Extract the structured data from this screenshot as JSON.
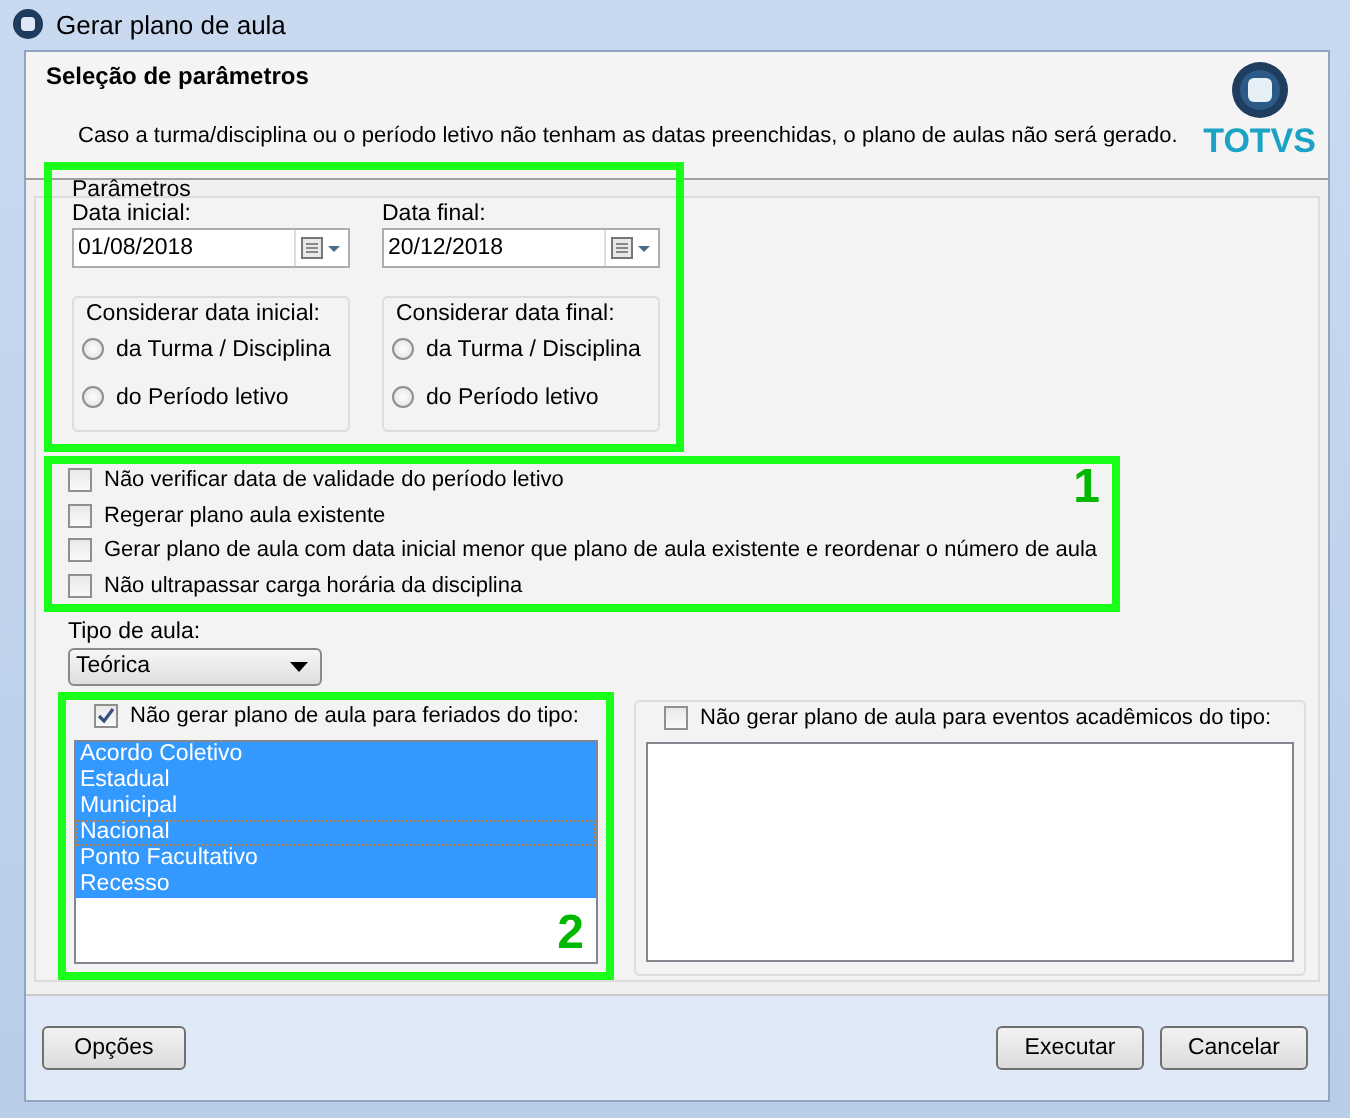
{
  "window": {
    "title": "Gerar plano de aula"
  },
  "header": {
    "title": "Seleção de parâmetros",
    "description": "Caso a turma/disciplina ou o período letivo não tenham as datas preenchidas, o plano de aulas não será gerado.",
    "logo_text": "TOTVS"
  },
  "parameters": {
    "legend": "Parâmetros",
    "highlighted": true,
    "dates": [
      {
        "label": "Data inicial:",
        "value": "01/08/2018",
        "group_label": "Considerar data inicial:",
        "options": [
          {
            "label": "da Turma / Disciplina",
            "selected": false
          },
          {
            "label": "do Período letivo",
            "selected": false
          }
        ]
      },
      {
        "label": "Data final:",
        "value": "20/12/2018",
        "group_label": "Considerar data final:",
        "options": [
          {
            "label": "da Turma / Disciplina",
            "selected": false
          },
          {
            "label": "do Período letivo",
            "selected": false
          }
        ]
      }
    ]
  },
  "options": {
    "highlight_label": "1",
    "checkboxes": [
      {
        "label": "Não verificar data de validade do período letivo",
        "checked": false
      },
      {
        "label": "Regerar plano aula existente",
        "checked": false
      },
      {
        "label": "Gerar plano de aula com data inicial menor que plano de aula existente e reordenar o número de aula",
        "checked": false
      },
      {
        "label": "Não ultrapassar carga horária da disciplina",
        "checked": false
      }
    ]
  },
  "lesson_type": {
    "label": "Tipo de aula:",
    "value": "Teórica"
  },
  "holidays": {
    "label": "Não gerar plano de aula para feriados do tipo:",
    "checked": true,
    "highlight_label": "2",
    "items": [
      {
        "label": "Acordo Coletivo",
        "selected": true,
        "focused": false
      },
      {
        "label": "Estadual",
        "selected": true,
        "focused": false
      },
      {
        "label": "Municipal",
        "selected": true,
        "focused": false
      },
      {
        "label": "Nacional",
        "selected": true,
        "focused": true
      },
      {
        "label": "Ponto Facultativo",
        "selected": true,
        "focused": false
      },
      {
        "label": "Recesso",
        "selected": true,
        "focused": false
      }
    ]
  },
  "events": {
    "label": "Não gerar plano de aula para eventos acadêmicos do tipo:",
    "checked": false
  },
  "buttons": [
    {
      "label": "Opções",
      "kind": "left"
    },
    {
      "label": "Executar",
      "kind": "right"
    },
    {
      "label": "Cancelar",
      "kind": "right"
    }
  ]
}
